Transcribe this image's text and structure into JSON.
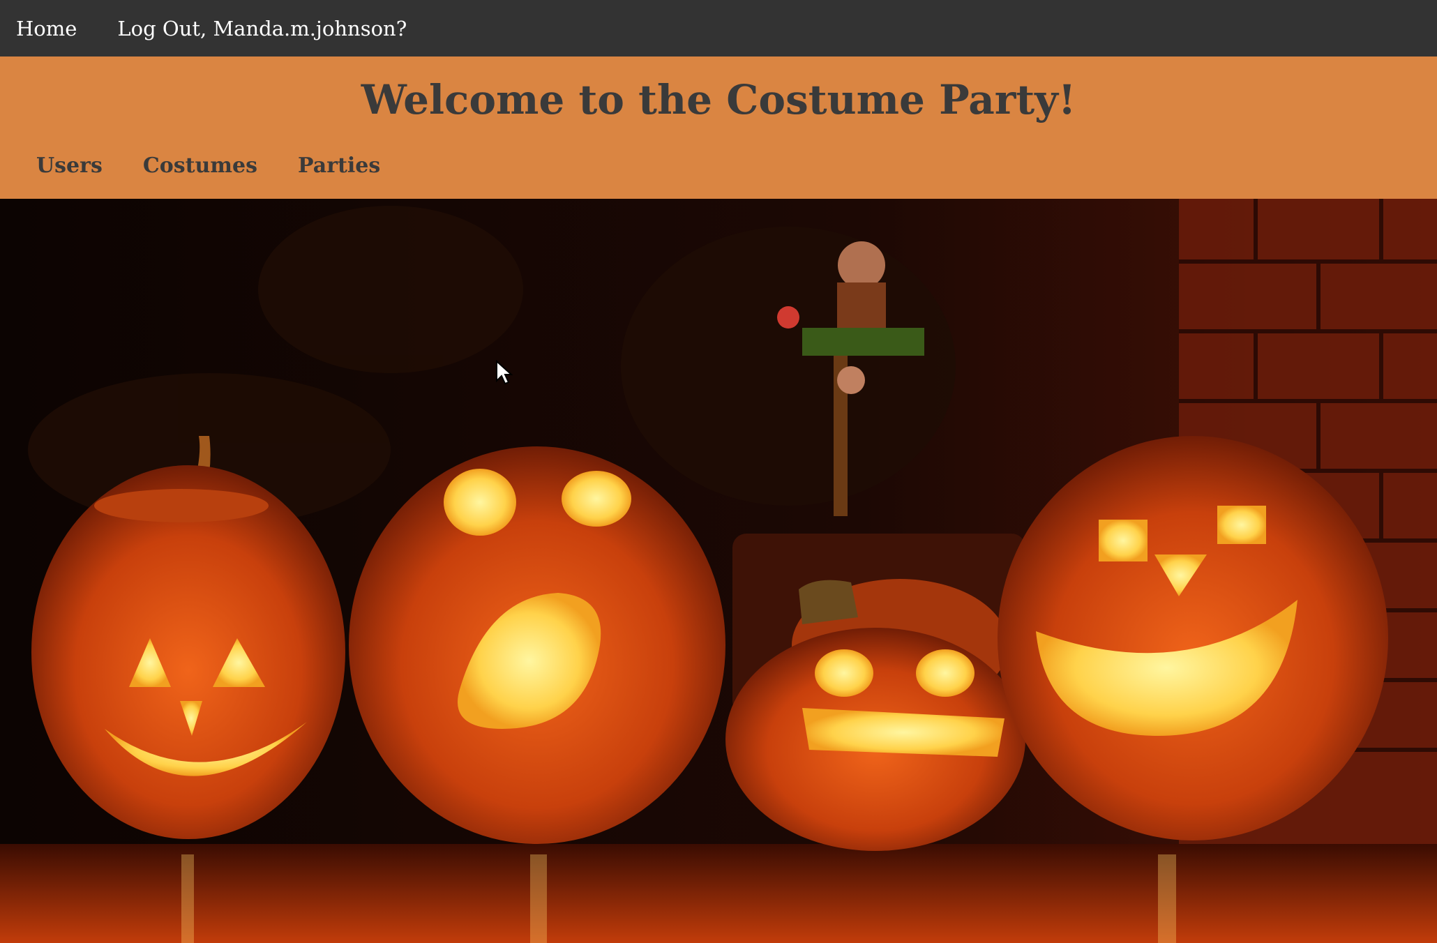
{
  "topbar": {
    "home_label": "Home",
    "logout_label": "Log Out, Manda.m.johnson?"
  },
  "header": {
    "title": "Welcome to the Costume Party!",
    "nav": [
      {
        "label": "Users"
      },
      {
        "label": "Costumes"
      },
      {
        "label": "Parties"
      }
    ]
  },
  "hero": {
    "icon": "jack-o-lantern-photo"
  },
  "colors": {
    "topbar_bg": "#333333",
    "header_bg": "#da8542",
    "header_text": "#3a3a3a",
    "topbar_text": "#ffffff"
  }
}
